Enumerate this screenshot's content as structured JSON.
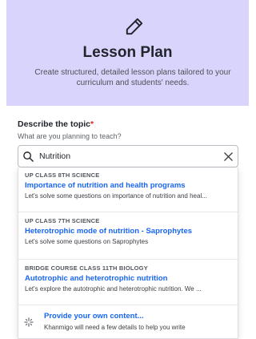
{
  "header": {
    "icon": "pencil-icon",
    "title": "Lesson Plan",
    "subtitle": "Create structured, detailed lesson plans tailored to your curriculum and students' needs."
  },
  "topic": {
    "label": "Describe the topic",
    "required_mark": "*",
    "hint": "What are you planning to teach?",
    "value": "Nutrition",
    "search_icon": "search-icon",
    "clear_icon": "close-icon"
  },
  "results": [
    {
      "meta": "UP CLASS 8TH SCIENCE",
      "title": "Importance of nutrition and health programs",
      "desc": "Let's solve some questions on importance of nutrition and heal..."
    },
    {
      "meta": "UP CLASS 7TH SCIENCE",
      "title": "Heterotrophic mode of nutrition - Saprophytes",
      "desc": "Let's solve some questions on Saprophytes"
    },
    {
      "meta": "BRIDGE COURSE CLASS 11TH BIOLOGY",
      "title": "Autotrophic and heterotrophic nutrition",
      "desc": "Let's explore the autotrophic and heterotrophic nutrition. We ..."
    }
  ],
  "own_content": {
    "icon": "sparkle-icon",
    "title": "Provide your own content...",
    "desc": "Khanmigo will need a few details to help you write"
  },
  "colors": {
    "header_bg": "#d9d4fb",
    "link": "#1865f2",
    "required": "#d92916"
  }
}
